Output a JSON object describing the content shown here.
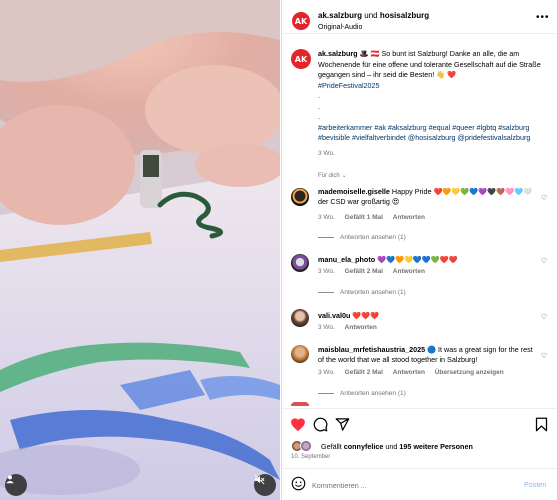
{
  "header": {
    "account_primary": "ak.salzburg",
    "connector": " und ",
    "account_secondary": "hosisalzburg",
    "audio": "Original-Audio",
    "avatar_text": "AK"
  },
  "caption": {
    "username": "ak.salzburg",
    "emoji": "🎩 🇦🇹",
    "text": " So bunt ist Salzburg! Danke an alle, die am Wochenende für eine offene und tolerante Gesellschaft auf die Straße gegangen sind – ihr seid die Besten! 👋 ❤️",
    "tag_line1": "#PrideFestival2025",
    "dots": [
      ".",
      ".",
      "."
    ],
    "tags_block": "#arbeiterkammer #ak #aksalzburg #equal #queer #lgbtq #salzburg #bevisible #vielfaltverbindet @hosisalzburg @pridefestivalsalzburg",
    "time": "3 Wo."
  },
  "filter_label": "Für dich",
  "comments": [
    {
      "username": "mademoiselle.giselle",
      "text": " Happy Pride ❤️🧡💛💚💙💜🖤🤎🩷🩵🤍 der CSD war großartig 😍",
      "time": "3 Wo.",
      "likes": "Gefällt 1 Mal",
      "reply": "Antworten",
      "replies": "Antworten ansehen (1)"
    },
    {
      "username": "manu_ela_photo",
      "text": " 💜💙🧡💛💙💙💚❤️❤️",
      "time": "3 Wo.",
      "likes": "Gefällt 2 Mal",
      "reply": "Antworten",
      "replies": "Antworten ansehen (1)"
    },
    {
      "username": "vali.val0u",
      "text": " ❤️❤️❤️",
      "time": "3 Wo.",
      "likes": "",
      "reply": "Antworten",
      "replies": ""
    },
    {
      "username": "maisblau_mrfetishaustria_2025",
      "text": " 🔵 It was a great sign for the rest of the world that we all stood together in Salzburg!",
      "time": "3 Wo.",
      "likes": "Gefällt 2 Mal",
      "reply": "Antworten",
      "translate": "Übersetzung anzeigen",
      "replies": "Antworten ansehen (1)"
    }
  ],
  "likes_line": {
    "prefix": "Gefällt ",
    "user": "connyfelice",
    "middle": " und ",
    "others": "195 weitere Personen"
  },
  "date": "10. September",
  "add_comment": {
    "placeholder": "Kommentieren ...",
    "post_label": "Posten"
  },
  "icons": {
    "like": "heart-filled-icon",
    "comment": "comment-bubble-icon",
    "share": "paper-plane-icon",
    "save": "bookmark-icon",
    "more": "more-dots-icon",
    "emoji": "smiley-icon",
    "mute": "speaker-muted-icon",
    "tagged_user": "user-icon"
  },
  "colors": {
    "brand_red": "#e3242b",
    "like_red": "#ff3040",
    "link_blue": "#00376b",
    "post_blue": "#8cb8f2"
  }
}
